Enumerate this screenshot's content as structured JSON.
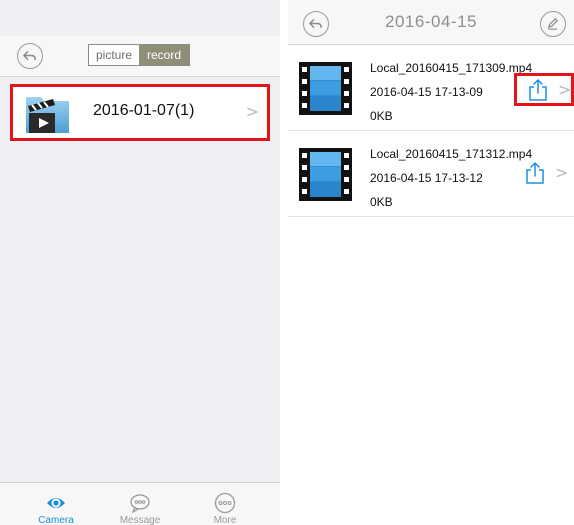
{
  "left": {
    "segments": [
      {
        "label": "picture",
        "active": false
      },
      {
        "label": "record",
        "active": true
      }
    ],
    "folder": {
      "label": "2016-01-07(1)"
    },
    "tabs": [
      {
        "label": "Camera",
        "icon": "eye-icon",
        "active": true
      },
      {
        "label": "Message",
        "icon": "message-icon",
        "active": false
      },
      {
        "label": "More",
        "icon": "more-icon",
        "active": false
      }
    ]
  },
  "right": {
    "title": "2016-04-15",
    "files": [
      {
        "name": "Local_20160415_171309.mp4",
        "datetime": "2016-04-15 17-13-09",
        "size": "0KB",
        "highlighted": true
      },
      {
        "name": "Local_20160415_171312.mp4",
        "datetime": "2016-04-15 17-13-12",
        "size": "0KB",
        "highlighted": false
      }
    ]
  },
  "colors": {
    "accent": "#1a8fe0",
    "highlight": "#e3141a",
    "segment_active": "#8f8f78"
  }
}
